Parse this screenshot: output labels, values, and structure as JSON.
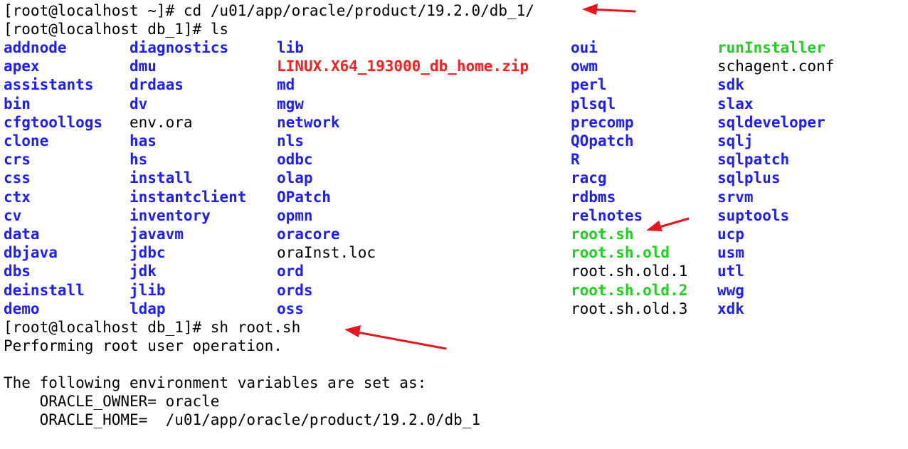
{
  "terminal": {
    "colors": {
      "background": "#ffffff",
      "text": "#000000",
      "directory": "#1d1dff",
      "executable": "#20d020",
      "archive": "#ff1e1e",
      "annotation_arrow": "#e8141e"
    },
    "lines": {
      "cmd_cd": "[root@localhost ~]# cd /u01/app/oracle/product/19.2.0/db_1/",
      "cmd_ls": "[root@localhost db_1]# ls",
      "cmd_root": "[root@localhost db_1]# sh root.sh",
      "out_performing": "Performing root user operation.",
      "out_env_header": "The following environment variables are set as:",
      "out_owner": "    ORACLE_OWNER= oracle",
      "out_home": "    ORACLE_HOME=  /u01/app/oracle/product/19.2.0/db_1"
    },
    "ls_rows": [
      [
        {
          "name": "addnode",
          "type": "dir"
        },
        {
          "name": "diagnostics",
          "type": "dir"
        },
        {
          "name": "lib",
          "type": "dir"
        },
        {
          "name": "oui",
          "type": "dir"
        },
        {
          "name": "runInstaller",
          "type": "exec"
        }
      ],
      [
        {
          "name": "apex",
          "type": "dir"
        },
        {
          "name": "dmu",
          "type": "dir"
        },
        {
          "name": "LINUX.X64_193000_db_home.zip",
          "type": "archive"
        },
        {
          "name": "owm",
          "type": "dir"
        },
        {
          "name": "schagent.conf",
          "type": "file"
        }
      ],
      [
        {
          "name": "assistants",
          "type": "dir"
        },
        {
          "name": "drdaas",
          "type": "dir"
        },
        {
          "name": "md",
          "type": "dir"
        },
        {
          "name": "perl",
          "type": "dir"
        },
        {
          "name": "sdk",
          "type": "dir"
        }
      ],
      [
        {
          "name": "bin",
          "type": "dir"
        },
        {
          "name": "dv",
          "type": "dir"
        },
        {
          "name": "mgw",
          "type": "dir"
        },
        {
          "name": "plsql",
          "type": "dir"
        },
        {
          "name": "slax",
          "type": "dir"
        }
      ],
      [
        {
          "name": "cfgtoollogs",
          "type": "dir"
        },
        {
          "name": "env.ora",
          "type": "file"
        },
        {
          "name": "network",
          "type": "dir"
        },
        {
          "name": "precomp",
          "type": "dir"
        },
        {
          "name": "sqldeveloper",
          "type": "dir"
        }
      ],
      [
        {
          "name": "clone",
          "type": "dir"
        },
        {
          "name": "has",
          "type": "dir"
        },
        {
          "name": "nls",
          "type": "dir"
        },
        {
          "name": "QOpatch",
          "type": "dir"
        },
        {
          "name": "sqlj",
          "type": "dir"
        }
      ],
      [
        {
          "name": "crs",
          "type": "dir"
        },
        {
          "name": "hs",
          "type": "dir"
        },
        {
          "name": "odbc",
          "type": "dir"
        },
        {
          "name": "R",
          "type": "dir"
        },
        {
          "name": "sqlpatch",
          "type": "dir"
        }
      ],
      [
        {
          "name": "css",
          "type": "dir"
        },
        {
          "name": "install",
          "type": "dir"
        },
        {
          "name": "olap",
          "type": "dir"
        },
        {
          "name": "racg",
          "type": "dir"
        },
        {
          "name": "sqlplus",
          "type": "dir"
        }
      ],
      [
        {
          "name": "ctx",
          "type": "dir"
        },
        {
          "name": "instantclient",
          "type": "dir"
        },
        {
          "name": "OPatch",
          "type": "dir"
        },
        {
          "name": "rdbms",
          "type": "dir"
        },
        {
          "name": "srvm",
          "type": "dir"
        }
      ],
      [
        {
          "name": "cv",
          "type": "dir"
        },
        {
          "name": "inventory",
          "type": "dir"
        },
        {
          "name": "opmn",
          "type": "dir"
        },
        {
          "name": "relnotes",
          "type": "dir"
        },
        {
          "name": "suptools",
          "type": "dir"
        }
      ],
      [
        {
          "name": "data",
          "type": "dir"
        },
        {
          "name": "javavm",
          "type": "dir"
        },
        {
          "name": "oracore",
          "type": "dir"
        },
        {
          "name": "root.sh",
          "type": "exec"
        },
        {
          "name": "ucp",
          "type": "dir"
        }
      ],
      [
        {
          "name": "dbjava",
          "type": "dir"
        },
        {
          "name": "jdbc",
          "type": "dir"
        },
        {
          "name": "oraInst.loc",
          "type": "file"
        },
        {
          "name": "root.sh.old",
          "type": "exec"
        },
        {
          "name": "usm",
          "type": "dir"
        }
      ],
      [
        {
          "name": "dbs",
          "type": "dir"
        },
        {
          "name": "jdk",
          "type": "dir"
        },
        {
          "name": "ord",
          "type": "dir"
        },
        {
          "name": "root.sh.old.1",
          "type": "file"
        },
        {
          "name": "utl",
          "type": "dir"
        }
      ],
      [
        {
          "name": "deinstall",
          "type": "dir"
        },
        {
          "name": "jlib",
          "type": "dir"
        },
        {
          "name": "ords",
          "type": "dir"
        },
        {
          "name": "root.sh.old.2",
          "type": "exec"
        },
        {
          "name": "wwg",
          "type": "dir"
        }
      ],
      [
        {
          "name": "demo",
          "type": "dir"
        },
        {
          "name": "ldap",
          "type": "dir"
        },
        {
          "name": "oss",
          "type": "dir"
        },
        {
          "name": "root.sh.old.3",
          "type": "file"
        },
        {
          "name": "xdk",
          "type": "dir"
        }
      ]
    ],
    "annotations": [
      {
        "name": "arrow-to-cd-command",
        "icon": "red-arrow-icon"
      },
      {
        "name": "arrow-to-root-sh",
        "icon": "red-arrow-icon"
      },
      {
        "name": "arrow-to-sh-root-sh-command",
        "icon": "red-arrow-icon"
      }
    ]
  }
}
